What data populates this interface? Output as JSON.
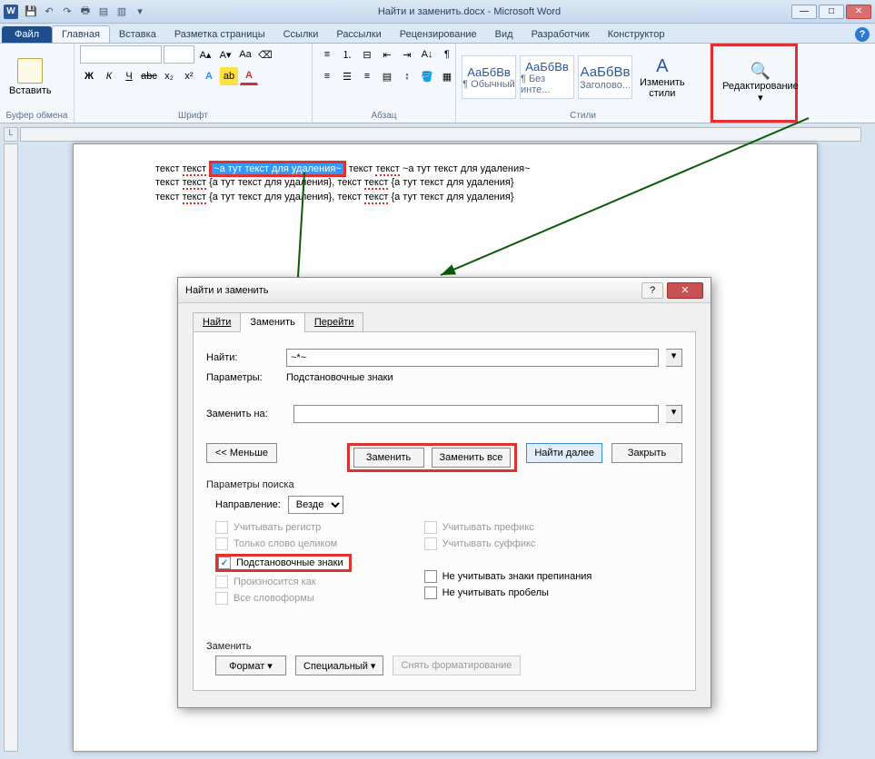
{
  "title": "Найти и заменить.docx - Microsoft Word",
  "qat": [
    "save",
    "undo",
    "redo",
    "print",
    "open",
    "new",
    "|"
  ],
  "win_btns": {
    "min": "—",
    "max": "□",
    "close": "✕"
  },
  "file_tab": "Файл",
  "tabs": [
    "Главная",
    "Вставка",
    "Разметка страницы",
    "Ссылки",
    "Рассылки",
    "Рецензирование",
    "Вид",
    "Разработчик",
    "Конструктор"
  ],
  "ribbon": {
    "clipboard": {
      "paste": "Вставить",
      "label": "Буфер обмена"
    },
    "font": {
      "label": "Шрифт",
      "bold": "Ж",
      "italic": "К",
      "underline": "Ч",
      "strike": "abc"
    },
    "para": {
      "label": "Абзац"
    },
    "styles": {
      "label": "Стили",
      "sample": "АаБбВв",
      "s1": "¶ Обычный",
      "s2": "¶ Без инте...",
      "s3": "Заголово...",
      "change": "Изменить\nстили"
    },
    "editing": {
      "label": "Редактирование"
    }
  },
  "ruler_corner": "L",
  "doc": {
    "pre": "текст ",
    "word": "текст",
    "sp": " ",
    "hl": "~а тут текст для удаления~",
    "tilde": " текст ",
    "tilde2": " ~а тут текст для удаления~",
    "brace": " {а тут текст для удаления}, текст ",
    "brace2": " {а тут текст для удаления}"
  },
  "dialog": {
    "title": "Найти и заменить",
    "tabs": {
      "find": "Найти",
      "replace": "Заменить",
      "goto": "Перейти"
    },
    "find_lbl": "Найти:",
    "find_val": "~*~",
    "params_lbl": "Параметры:",
    "params_val": "Подстановочные знаки",
    "replace_lbl": "Заменить на:",
    "replace_val": "",
    "less": "<< Меньше",
    "replace_btn": "Заменить",
    "replace_all": "Заменить все",
    "find_next": "Найти далее",
    "close": "Закрыть",
    "search_params": "Параметры поиска",
    "direction": "Направление:",
    "dir_val": "Везде",
    "chk_case": "Учитывать регистр",
    "chk_whole": "Только слово целиком",
    "chk_wild": "Подстановочные знаки",
    "chk_sounds": "Произносится как",
    "chk_forms": "Все словоформы",
    "chk_prefix": "Учитывать префикс",
    "chk_suffix": "Учитывать суффикс",
    "chk_punct": "Не учитывать знаки препинания",
    "chk_space": "Не учитывать пробелы",
    "replace_grp": "Заменить",
    "format": "Формат ▾",
    "special": "Специальный ▾",
    "nofmt": "Снять форматирование"
  }
}
